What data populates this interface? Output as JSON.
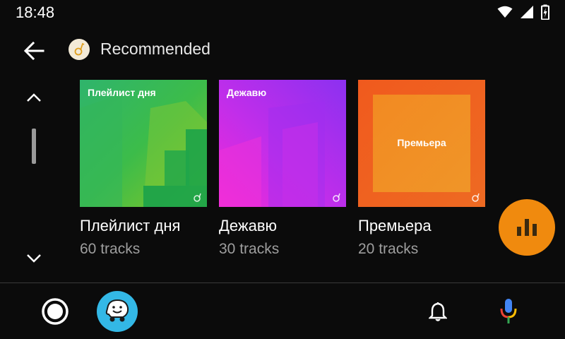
{
  "status": {
    "time": "18:48"
  },
  "header": {
    "title": "Recommended",
    "back_icon": "arrow-left-icon",
    "source_icon": "yandex-music-icon"
  },
  "scroll": {
    "up_icon": "chevron-up-icon",
    "down_icon": "chevron-down-icon"
  },
  "cards": [
    {
      "cover_text": "Плейлист дня",
      "title": "Плейлист дня",
      "subtitle": "60 tracks",
      "color": "#2db45a"
    },
    {
      "cover_text": "Дежавю",
      "title": "Дежавю",
      "subtitle": "30 tracks",
      "color": "#b52ee8"
    },
    {
      "cover_text": "Премьера",
      "title": "Премьера",
      "subtitle": "20 tracks",
      "color": "#f0641e"
    }
  ],
  "fab": {
    "icon": "equalizer-icon",
    "color": "#f08a0e"
  },
  "nav": {
    "home_icon": "home-circle-icon",
    "waze_icon": "waze-icon",
    "bell_icon": "notifications-bell-icon",
    "mic_icon": "microphone-icon"
  }
}
